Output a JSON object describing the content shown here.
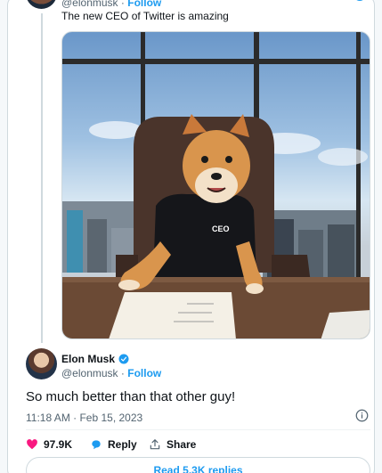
{
  "quoted": {
    "handle": "@elonmusk",
    "separator": "·",
    "follow": "Follow",
    "text": "The new CEO of Twitter is amazing"
  },
  "photo": {
    "badge_text": "CEO"
  },
  "tweet": {
    "name": "Elon Musk",
    "handle": "@elonmusk",
    "separator": "·",
    "follow": "Follow",
    "text": "So much better than that other guy!",
    "timestamp": "11:18 AM · Feb 15, 2023"
  },
  "actions": {
    "likes": "97.9K",
    "reply": "Reply",
    "share": "Share"
  },
  "replies_button": "Read 5.3K replies",
  "colors": {
    "accent": "#1d9bf0",
    "like": "#f91880",
    "text": "#0f1419",
    "muted": "#536471"
  }
}
